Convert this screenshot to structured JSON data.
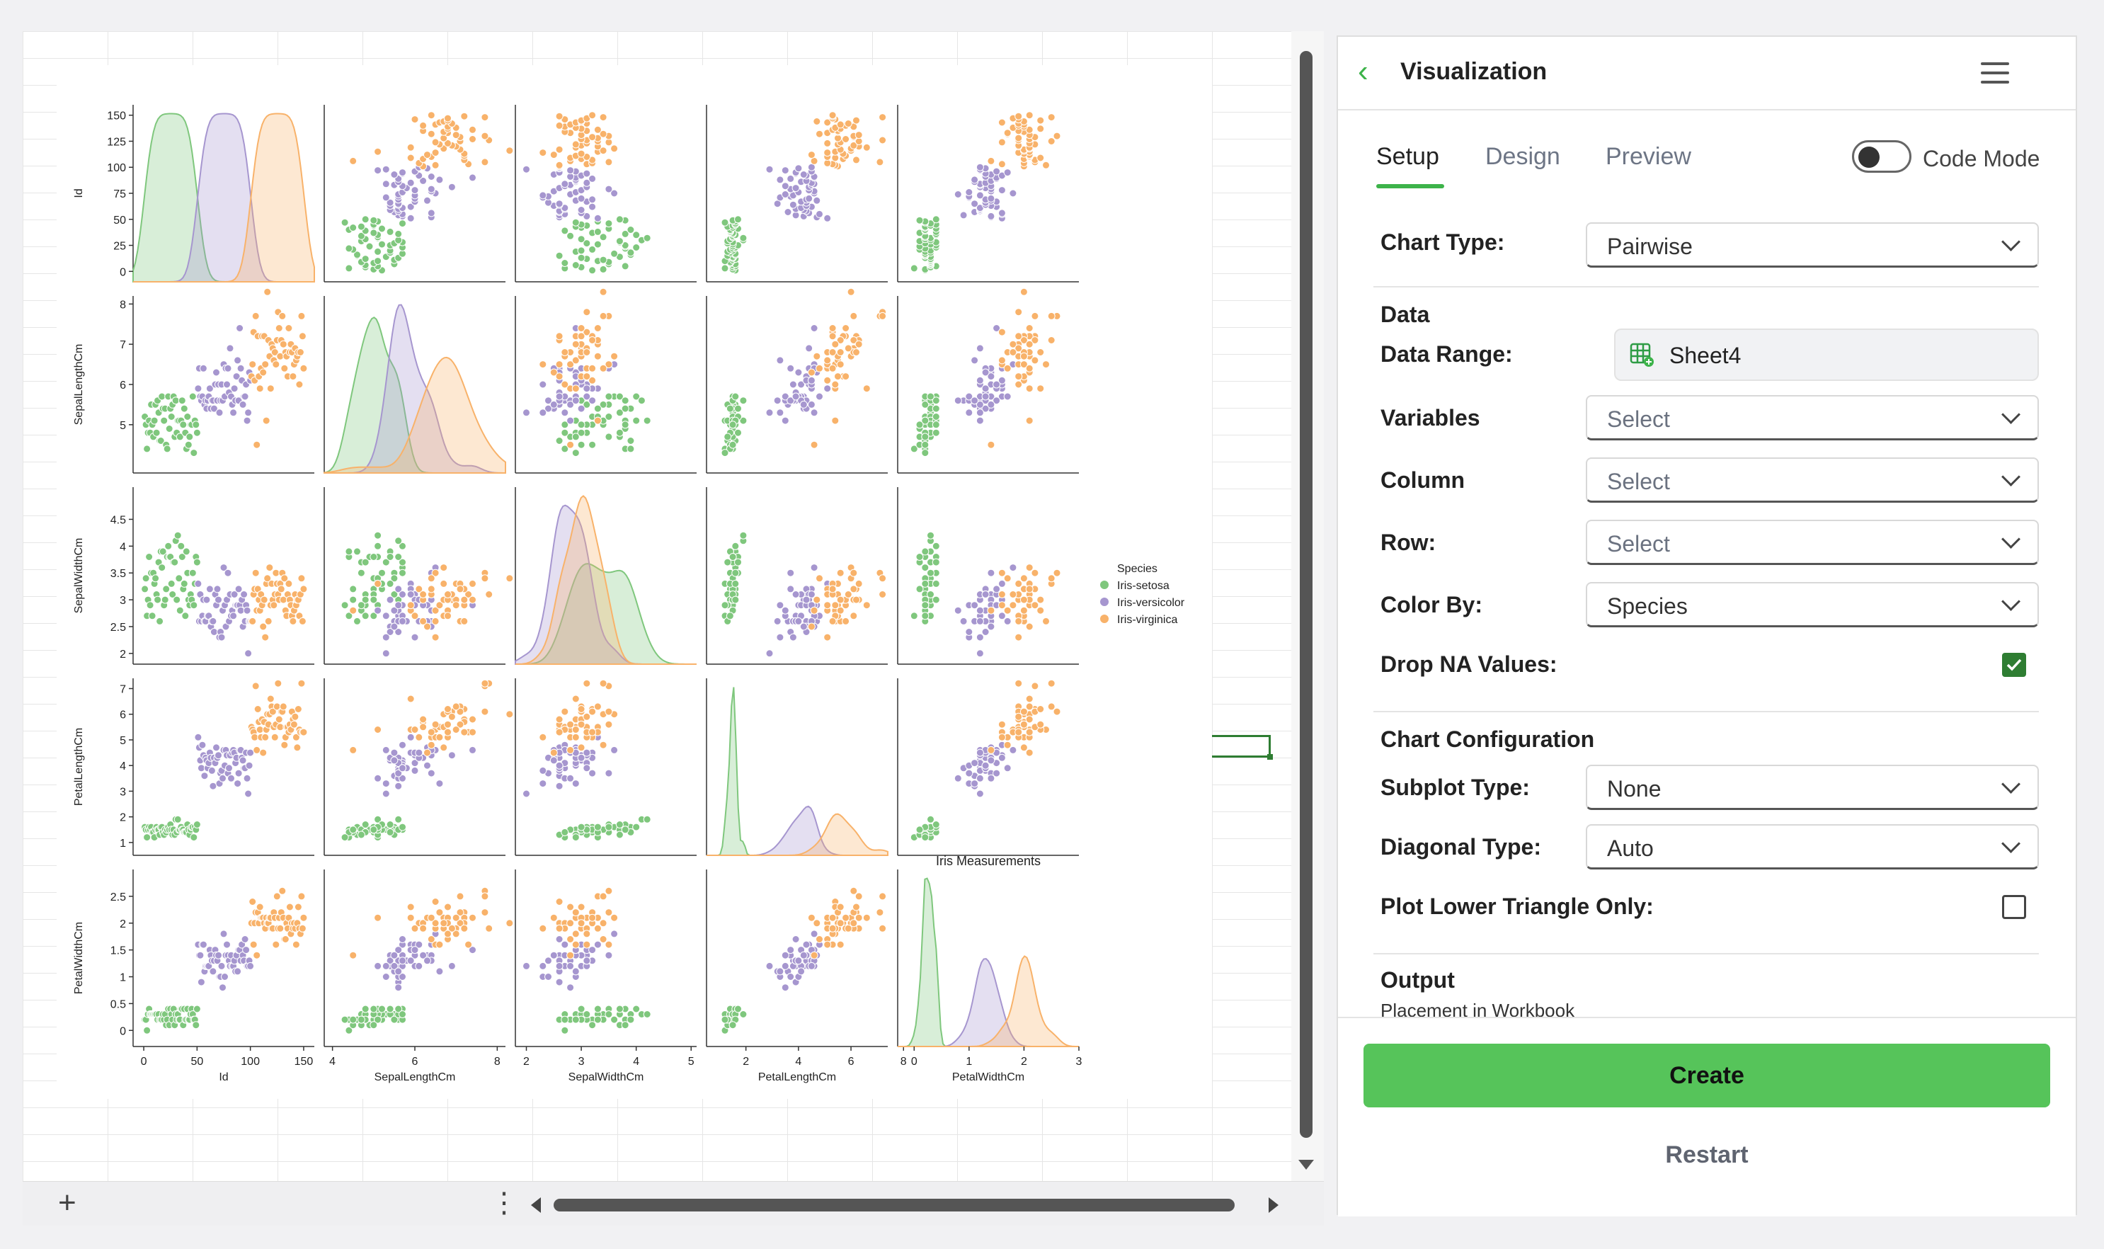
{
  "panel": {
    "title": "Visualization",
    "tabs": [
      "Setup",
      "Design",
      "Preview"
    ],
    "code_mode_label": "Code Mode",
    "code_mode_on": false,
    "fields": {
      "chart_type": {
        "label": "Chart Type:",
        "value": "Pairwise"
      },
      "data_section": "Data",
      "data_range": {
        "label": "Data Range:",
        "value": "Sheet4"
      },
      "variables": {
        "label": "Variables",
        "value": "Select"
      },
      "column": {
        "label": "Column",
        "value": "Select"
      },
      "row": {
        "label": "Row:",
        "value": "Select"
      },
      "color_by": {
        "label": "Color By:",
        "value": "Species"
      },
      "drop_na": {
        "label": "Drop NA Values:",
        "checked": true
      },
      "config_section": "Chart Configuration",
      "subplot_type": {
        "label": "Subplot Type:",
        "value": "None"
      },
      "diagonal_type": {
        "label": "Diagonal Type:",
        "value": "Auto"
      },
      "lower_triangle": {
        "label": "Plot Lower Triangle Only:",
        "checked": false
      },
      "output_section": "Output",
      "placement": "Placement in Workbook"
    },
    "create_label": "Create",
    "restart_label": "Restart"
  },
  "sheet": {
    "add_label": "+",
    "more_label": "⋮"
  },
  "icons": [
    "chevron-left-icon",
    "hamburger-menu-icon",
    "chevron-down-icon",
    "sheet-icon",
    "checkbox-icon",
    "plus-icon",
    "more-vert-icon"
  ],
  "colors": {
    "accent": "#56c45a",
    "setosa": "#7fc77d",
    "versicolor": "#a696cf",
    "virginica": "#f8b26a"
  },
  "chart_data": {
    "type": "scatter",
    "subtitle": "Iris Measurements",
    "variables": [
      "Id",
      "SepalLengthCm",
      "SepalWidthCm",
      "PetalLengthCm",
      "PetalWidthCm"
    ],
    "ranges": {
      "Id": [
        -10,
        160
      ],
      "SepalLengthCm": [
        3.8,
        8.2
      ],
      "SepalWidthCm": [
        1.8,
        5.1
      ],
      "PetalLengthCm": [
        0.5,
        7.4
      ],
      "PetalWidthCm": [
        -0.3,
        3.0
      ]
    },
    "ticks": {
      "Id": [
        0,
        25,
        50,
        75,
        100,
        125,
        150
      ],
      "Id_x": [
        0,
        50,
        100,
        150
      ],
      "SepalLengthCm": [
        5,
        6,
        7,
        8
      ],
      "SepalLengthCm_x": [
        4,
        6,
        8
      ],
      "SepalWidthCm": [
        2.0,
        2.5,
        3.0,
        3.5,
        4.0,
        4.5
      ],
      "SepalWidthCm_x": [
        2,
        3,
        4,
        5
      ],
      "PetalLengthCm": [
        1,
        2,
        3,
        4,
        5,
        6,
        7
      ],
      "PetalLengthCm_x": [
        2,
        4,
        6,
        8
      ],
      "PetalWidthCm": [
        0.0,
        0.5,
        1.0,
        1.5,
        2.0,
        2.5
      ],
      "PetalWidthCm_x": [
        0,
        1,
        2,
        3
      ]
    },
    "legend": {
      "title": "Species",
      "entries": [
        "Iris-setosa",
        "Iris-versicolor",
        "Iris-virginica"
      ],
      "placement": "right"
    },
    "series": [
      {
        "name": "Iris-setosa",
        "id_range": [
          1,
          50
        ],
        "sepal_length": [
          5.0,
          0.35
        ],
        "sepal_width": [
          3.42,
          0.38
        ],
        "petal_length": [
          1.46,
          0.17
        ],
        "petal_width": [
          0.24,
          0.11
        ]
      },
      {
        "name": "Iris-versicolor",
        "id_range": [
          51,
          100
        ],
        "sepal_length": [
          5.94,
          0.52
        ],
        "sepal_width": [
          2.77,
          0.31
        ],
        "petal_length": [
          4.26,
          0.47
        ],
        "petal_width": [
          1.33,
          0.2
        ]
      },
      {
        "name": "Iris-virginica",
        "id_range": [
          101,
          150
        ],
        "sepal_length": [
          6.59,
          0.64
        ],
        "sepal_width": [
          2.97,
          0.32
        ],
        "petal_length": [
          5.55,
          0.55
        ],
        "petal_width": [
          2.03,
          0.27
        ]
      }
    ],
    "diagonal": "kde"
  }
}
